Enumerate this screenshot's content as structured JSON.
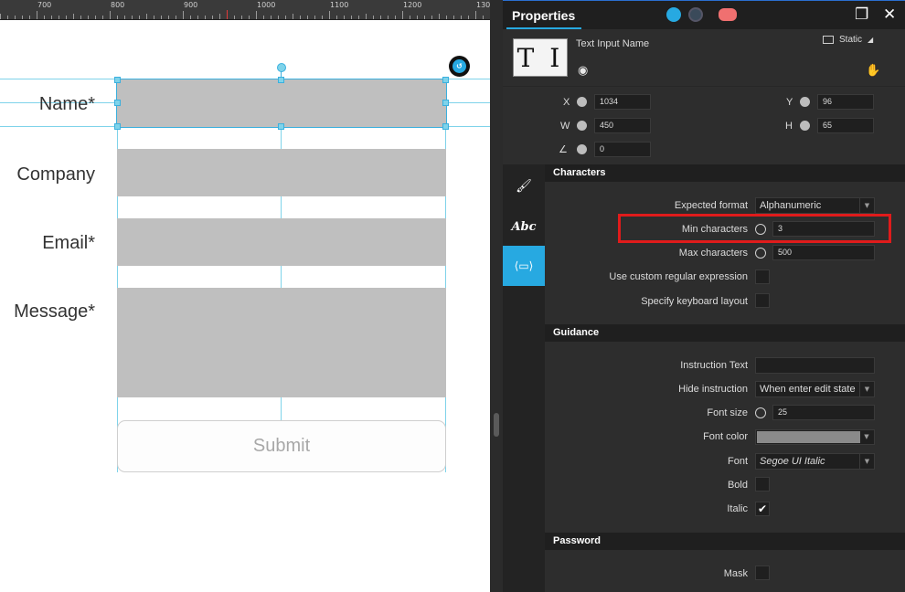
{
  "ruler": {
    "labels": [
      "700",
      "800",
      "900",
      "1000",
      "1100",
      "1200",
      "130"
    ]
  },
  "form": {
    "labels": [
      "Name*",
      "Company",
      "Email*",
      "Message*"
    ],
    "submit_label": "Submit"
  },
  "panel": {
    "title": "Properties",
    "object_name": "Text Input Name",
    "thumbnail_glyph": "T I",
    "mode_label": "Static",
    "restore_symbol": "❐",
    "close_symbol": "✕"
  },
  "geometry": {
    "x_label": "X",
    "x_value": "1034",
    "y_label": "Y",
    "y_value": "96",
    "w_label": "W",
    "w_value": "450",
    "h_label": "H",
    "h_value": "65",
    "angle_value": "0"
  },
  "side_tabs": {
    "brush": "brush-icon",
    "text": "Abc",
    "widget": "widget-icon"
  },
  "characters": {
    "section_title": "Characters",
    "expected_format_label": "Expected format",
    "expected_format_value": "Alphanumeric",
    "min_chars_label": "Min characters",
    "min_chars_value": "3",
    "max_chars_label": "Max characters",
    "max_chars_value": "500",
    "custom_regex_label": "Use custom regular expression",
    "keyboard_layout_label": "Specify keyboard layout"
  },
  "guidance": {
    "section_title": "Guidance",
    "instruction_text_label": "Instruction Text",
    "instruction_text_value": "",
    "hide_instruction_label": "Hide instruction",
    "hide_instruction_value": "When enter edit state",
    "font_size_label": "Font size",
    "font_size_value": "25",
    "font_color_label": "Font color",
    "font_color_value": "#8a8a8a",
    "font_label": "Font",
    "font_value": "Segoe UI Italic",
    "bold_label": "Bold",
    "italic_label": "Italic",
    "italic_checked": "✔"
  },
  "password": {
    "section_title": "Password",
    "mask_label": "Mask"
  },
  "colors": {
    "accent": "#27a9e1",
    "highlight": "#e01b1b",
    "guide": "#7fd3ea"
  }
}
